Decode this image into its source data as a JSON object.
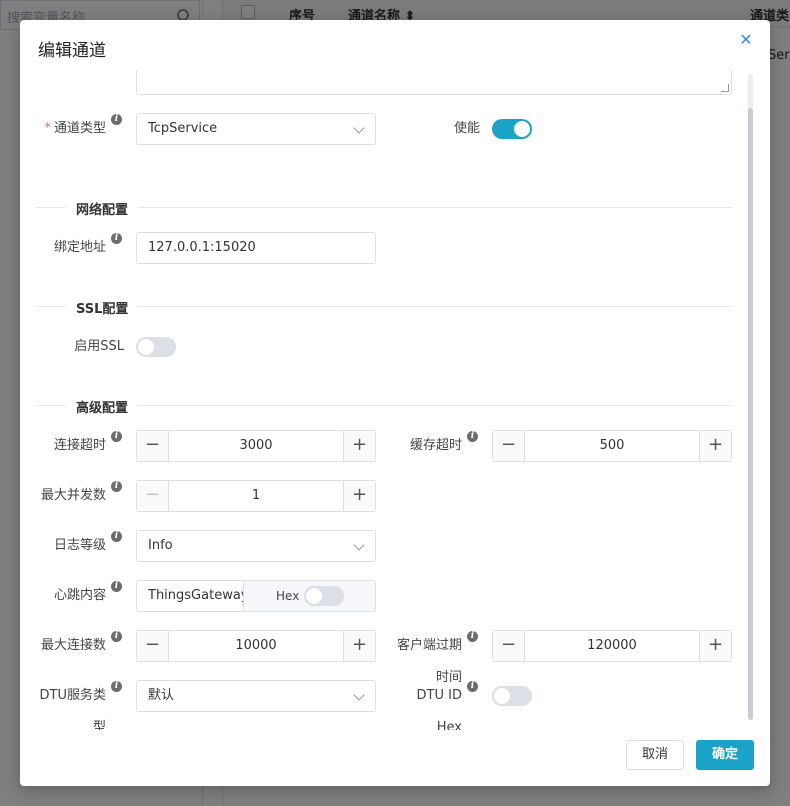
{
  "background": {
    "search_placeholder": "搜索变量名称",
    "table_headers": [
      "序号",
      "通道名称 ⬍",
      "通道类型"
    ],
    "cell_text": "Servi"
  },
  "dialog": {
    "title": "编辑通道",
    "fields": {
      "channel_type": {
        "label": "通道类型",
        "value": "TcpService",
        "required": true
      },
      "enable": {
        "label": "使能",
        "on": true
      },
      "bind_address": {
        "label": "绑定地址",
        "value": "127.0.0.1:15020"
      },
      "ssl_enable": {
        "label": "启用SSL",
        "on": false
      },
      "connect_timeout": {
        "label": "连接超时",
        "value": "3000"
      },
      "cache_timeout": {
        "label": "缓存超时",
        "value": "500"
      },
      "max_concurrent": {
        "label": "最大并发数",
        "value": "1"
      },
      "log_level": {
        "label": "日志等级",
        "value": "Info"
      },
      "heartbeat": {
        "label": "心跳内容",
        "value": "ThingsGateway",
        "hex_label": "Hex",
        "hex_on": false
      },
      "max_connections": {
        "label": "最大连接数",
        "value": "10000"
      },
      "client_expire": {
        "label": "客户端过期",
        "label_line2": "时间",
        "value": "120000"
      },
      "dtu_service_type": {
        "label": "DTU服务类",
        "label_line2": "型",
        "value": "默认"
      },
      "dtu_id_hex": {
        "label": "DTU ID",
        "label_line2": "Hex",
        "on": false
      }
    },
    "sections": {
      "network": "网络配置",
      "ssl": "SSL配置",
      "advanced": "高级配置"
    },
    "buttons": {
      "cancel": "取消",
      "ok": "确定"
    }
  },
  "colors": {
    "accent": "#1aa3c7",
    "required": "#f56c6c"
  }
}
